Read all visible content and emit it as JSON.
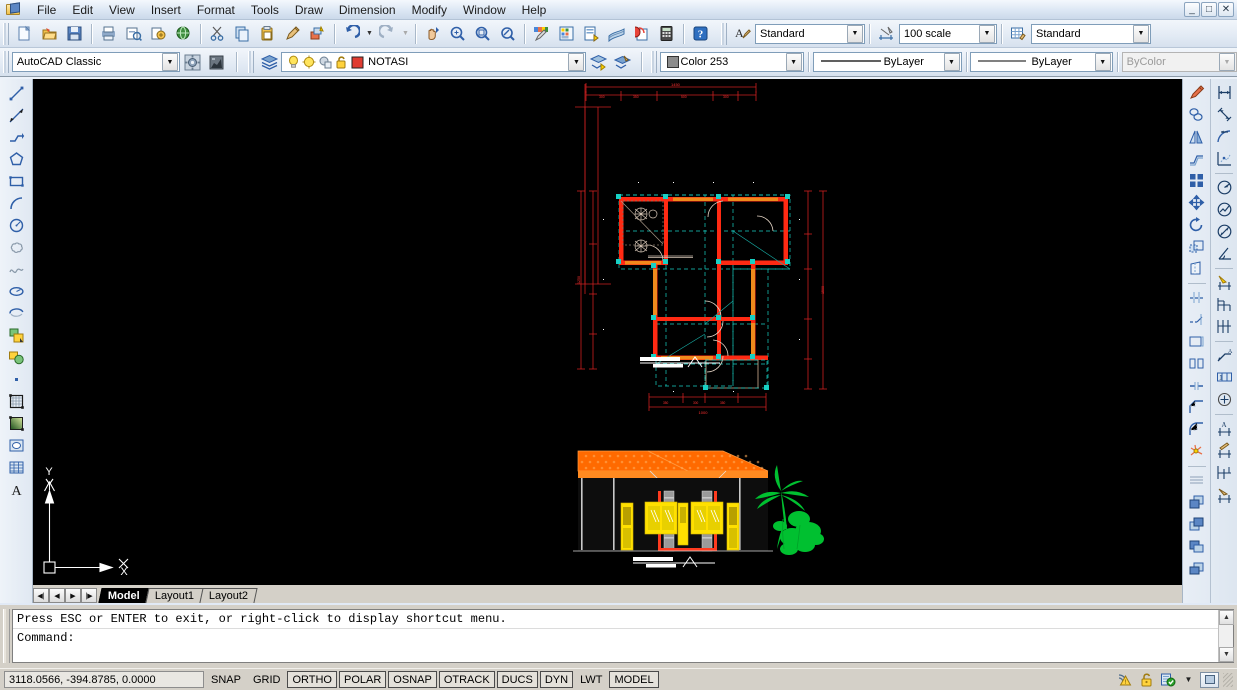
{
  "window": {
    "app_icon": "autocad-app-icon",
    "minimize_label": "_",
    "maximize_label": "□",
    "close_label": "✕"
  },
  "menubar": {
    "items": [
      {
        "label": "File",
        "name": "menu-file"
      },
      {
        "label": "Edit",
        "name": "menu-edit"
      },
      {
        "label": "View",
        "name": "menu-view"
      },
      {
        "label": "Insert",
        "name": "menu-insert"
      },
      {
        "label": "Format",
        "name": "menu-format"
      },
      {
        "label": "Tools",
        "name": "menu-tools"
      },
      {
        "label": "Draw",
        "name": "menu-draw"
      },
      {
        "label": "Dimension",
        "name": "menu-dimension"
      },
      {
        "label": "Modify",
        "name": "menu-modify"
      },
      {
        "label": "Window",
        "name": "menu-window"
      },
      {
        "label": "Help",
        "name": "menu-help"
      }
    ]
  },
  "standard_toolbar": {
    "buttons": [
      "new-icon",
      "open-icon",
      "save-icon",
      "plot-icon",
      "plot-preview-icon",
      "publish-icon",
      "publish-web-icon",
      "cut-icon",
      "copy-icon",
      "paste-icon",
      "match-properties-icon",
      "block-editor-icon",
      "undo-icon",
      "redo-icon",
      "pan-icon",
      "zoom-realtime-icon",
      "zoom-window-icon",
      "zoom-previous-icon",
      "properties-icon",
      "designcenter-icon",
      "tool-palettes-icon",
      "sheet-set-icon",
      "markup-set-icon",
      "quickcalc-icon",
      "help-icon"
    ]
  },
  "styles_toolbar": {
    "text_style": {
      "icon": "text-style-icon",
      "value": "Standard"
    },
    "dim_style": {
      "icon": "dimension-style-icon",
      "value": "100 scale"
    },
    "table_style": {
      "icon": "table-style-icon",
      "value": "Standard"
    }
  },
  "workspaces_toolbar": {
    "workspace": {
      "value": "AutoCAD Classic"
    },
    "settings_icon": "workspace-settings-icon",
    "lock_icon": "toolbar-lock-icon"
  },
  "layers_toolbar": {
    "layer_properties_icon": "layer-properties-manager-icon",
    "layer": {
      "on_icon": "lightbulb-on-icon",
      "freeze_icon": "sun-thaw-icon",
      "freeze_vp_icon": "freeze-viewport-icon",
      "lock_icon": "layer-unlocked-icon",
      "color_swatch": "#e03c31",
      "name": "NOTASI"
    },
    "layer_previous_icon": "layer-previous-icon",
    "make_current_icon": "make-object-layer-current-icon"
  },
  "properties_toolbar": {
    "color": {
      "swatch": "#8c8c8c",
      "value": "Color 253"
    },
    "linetype": {
      "value": "ByLayer"
    },
    "lineweight": {
      "value": "ByLayer"
    },
    "plotstyle": {
      "value": "ByColor",
      "disabled": true
    }
  },
  "draw_toolbar": {
    "buttons": [
      "line-icon",
      "construction-line-icon",
      "polyline-icon",
      "polygon-icon",
      "rectangle-icon",
      "arc-icon",
      "circle-icon",
      "revision-cloud-icon",
      "spline-icon",
      "ellipse-icon",
      "ellipse-arc-icon",
      "insert-block-icon",
      "make-block-icon",
      "point-icon",
      "hatch-icon",
      "gradient-icon",
      "region-icon",
      "table-icon",
      "multiline-text-icon"
    ]
  },
  "modify_toolbar": {
    "buttons": [
      "erase-icon",
      "copy-object-icon",
      "mirror-icon",
      "offset-icon",
      "array-icon",
      "move-icon",
      "rotate-icon",
      "scale-icon",
      "stretch-icon",
      "trim-icon",
      "extend-icon",
      "break-at-point-icon",
      "break-icon",
      "join-icon",
      "chamfer-icon",
      "fillet-icon",
      "explode-icon",
      "draworder-icon",
      "bring-to-front-icon",
      "send-to-back-icon",
      "bring-above-icon",
      "send-under-icon"
    ]
  },
  "dimension_toolbar": {
    "buttons": [
      "linear-dimension-icon",
      "aligned-dimension-icon",
      "arc-length-icon",
      "ordinate-dimension-icon",
      "radius-dimension-icon",
      "jogged-dimension-icon",
      "diameter-dimension-icon",
      "angular-dimension-icon",
      "quick-dimension-icon",
      "baseline-dimension-icon",
      "continue-dimension-icon",
      "quick-leader-icon",
      "tolerance-icon",
      "center-mark-icon",
      "dimension-edit-icon",
      "dimension-text-edit-icon",
      "dimension-update-icon",
      "dimension-style-control-icon"
    ]
  },
  "drawing": {
    "ucs_icon": {
      "x_label": "X",
      "y_label": "Y",
      "name": "ucs-icon"
    },
    "floor_plan": {
      "name": "floor-plan-drawing",
      "wall_color": "#ff2a13",
      "wall_fill": "#f08a1c",
      "grip_color": "#17d6c8",
      "dimension_color": "#ff2020"
    },
    "elevation": {
      "name": "house-elevation-drawing",
      "roof_color": "#ff6a00",
      "wall_color": "#c0c0c0",
      "window_color": "#ffe000",
      "tree_color": "#00c030"
    },
    "plan_title_underline": "title-underline",
    "elevation_title_underline": "title-underline"
  },
  "tabbar": {
    "nav_first": "◀|",
    "nav_prev": "◀",
    "nav_next": "▶",
    "nav_last": "|▶",
    "tabs": [
      {
        "label": "Model",
        "active": true
      },
      {
        "label": "Layout1",
        "active": false
      },
      {
        "label": "Layout2",
        "active": false
      }
    ]
  },
  "command_window": {
    "line1": "Press ESC or ENTER to exit, or right-click to display shortcut menu.",
    "line2": "Command:",
    "scroll_up": "▲",
    "scroll_down": "▼",
    "scroll_left": "◀",
    "scroll_right": "▶"
  },
  "statusbar": {
    "coordinates": "3118.0566, -394.8785, 0.0000",
    "toggles": [
      {
        "label": "SNAP",
        "on": false
      },
      {
        "label": "GRID",
        "on": false
      },
      {
        "label": "ORTHO",
        "on": true
      },
      {
        "label": "POLAR",
        "on": true
      },
      {
        "label": "OSNAP",
        "on": true
      },
      {
        "label": "OTRACK",
        "on": true
      },
      {
        "label": "DUCS",
        "on": true
      },
      {
        "label": "DYN",
        "on": true
      },
      {
        "label": "LWT",
        "on": false
      },
      {
        "label": "MODEL",
        "on": true
      }
    ],
    "tray_icons": [
      "communication-center-icon",
      "security-unlocked-icon",
      "manage-xrefs-icon"
    ],
    "tray_caret": "▼",
    "clean_screen_icon": "clean-screen-icon"
  }
}
